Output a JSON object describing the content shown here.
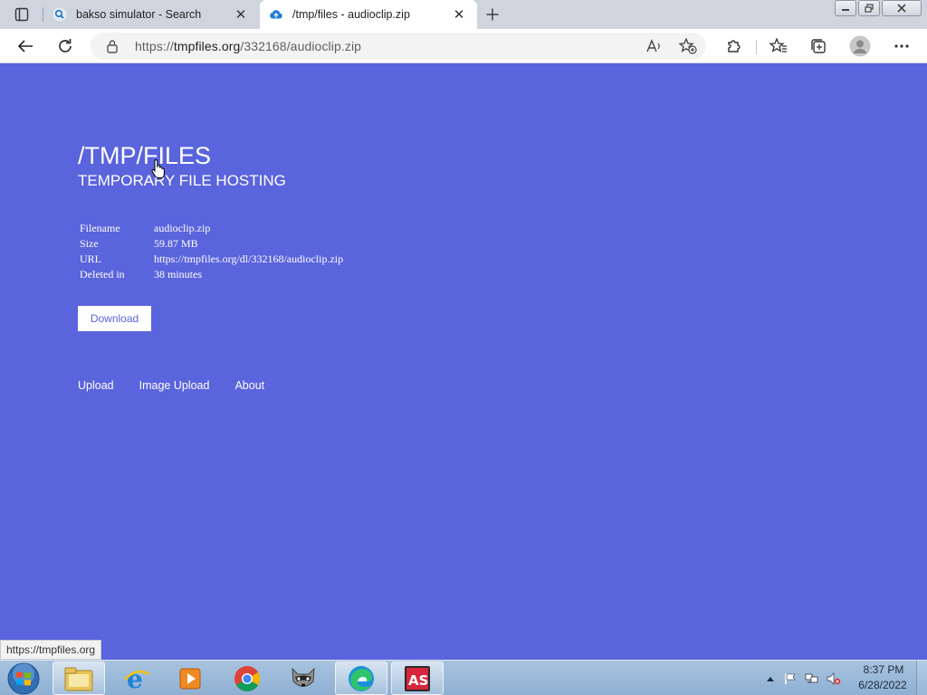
{
  "browser": {
    "tabs": [
      {
        "title": "bakso simulator - Search",
        "icon": "search-icon",
        "active": false
      },
      {
        "title": "/tmp/files - audioclip.zip",
        "icon": "cloud-upload-icon",
        "active": true
      }
    ],
    "address": {
      "scheme": "https://",
      "host": "tmpfiles.org",
      "path": "/332168/audioclip.zip"
    },
    "status_tooltip": "https://tmpfiles.org"
  },
  "page": {
    "title": "/TMP/FILES",
    "subtitle": "TEMPORARY FILE HOSTING",
    "file_info": [
      {
        "label": "Filename",
        "value": "audioclip.zip"
      },
      {
        "label": "Size",
        "value": "59.87 MB"
      },
      {
        "label": "URL",
        "value": "https://tmpfiles.org/dl/332168/audioclip.zip"
      },
      {
        "label": "Deleted in",
        "value": "38 minutes"
      }
    ],
    "download_label": "Download",
    "footer_links": [
      "Upload",
      "Image Upload",
      "About"
    ],
    "background_color": "#5a64dc"
  },
  "taskbar": {
    "apps": [
      "windows-explorer",
      "internet-explorer",
      "media-player",
      "google-chrome",
      "raccoon-app",
      "microsoft-edge",
      "adobe-as-app"
    ],
    "clock_time": "8:37 PM",
    "clock_date": "6/28/2022"
  }
}
